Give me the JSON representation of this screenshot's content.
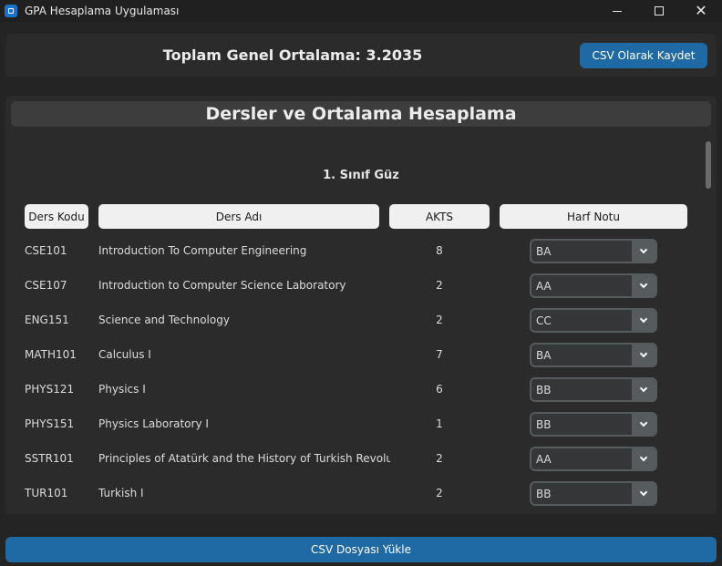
{
  "window": {
    "title": "GPA Hesaplama Uygulaması",
    "icon": "app-icon"
  },
  "top": {
    "gpa_text": "Toplam Genel Ortalama: 3.2035",
    "save_label": "CSV Olarak Kaydet"
  },
  "main": {
    "title": "Dersler ve Ortalama Hesaplama",
    "semester": "1. Sınıf Güz",
    "headers": {
      "code": "Ders Kodu",
      "name": "Ders Adı",
      "akts": "AKTS",
      "grade": "Harf Notu"
    },
    "courses": [
      {
        "code": "CSE101",
        "name": "Introduction To Computer Engineering",
        "akts": "8",
        "grade": "BA"
      },
      {
        "code": "CSE107",
        "name": "Introduction to Computer Science Laboratory",
        "akts": "2",
        "grade": "AA"
      },
      {
        "code": "ENG151",
        "name": "Science and Technology",
        "akts": "2",
        "grade": "CC"
      },
      {
        "code": "MATH101",
        "name": "Calculus I",
        "akts": "7",
        "grade": "BA"
      },
      {
        "code": "PHYS121",
        "name": "Physics I",
        "akts": "6",
        "grade": "BB"
      },
      {
        "code": "PHYS151",
        "name": "Physics Laboratory I",
        "akts": "1",
        "grade": "BB"
      },
      {
        "code": "SSTR101",
        "name": "Principles of Atatürk and the History of Turkish Revolut",
        "akts": "2",
        "grade": "AA"
      },
      {
        "code": "TUR101",
        "name": "Turkish I",
        "akts": "2",
        "grade": "BB"
      }
    ]
  },
  "bottom": {
    "load_label": "CSV Dosyası Yükle"
  },
  "colors": {
    "accent": "#1f6aa5",
    "background": "#242424",
    "panel": "#2b2b2b"
  }
}
